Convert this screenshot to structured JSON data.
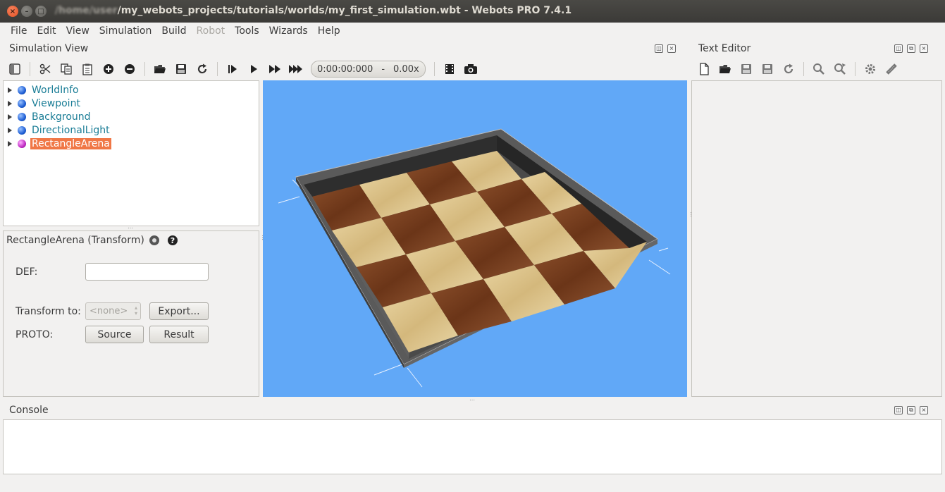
{
  "window": {
    "title_blurred": "/home/user",
    "title": "/my_webots_projects/tutorials/worlds/my_first_simulation.wbt - Webots PRO 7.4.1"
  },
  "menu": [
    {
      "label": "File",
      "enabled": true
    },
    {
      "label": "Edit",
      "enabled": true
    },
    {
      "label": "View",
      "enabled": true
    },
    {
      "label": "Simulation",
      "enabled": true
    },
    {
      "label": "Build",
      "enabled": true
    },
    {
      "label": "Robot",
      "enabled": false
    },
    {
      "label": "Tools",
      "enabled": true
    },
    {
      "label": "Wizards",
      "enabled": true
    },
    {
      "label": "Help",
      "enabled": true
    }
  ],
  "simulation_view": {
    "title": "Simulation View",
    "time": "0:00:00:000",
    "separator": "-",
    "speed": "0.00x"
  },
  "scene_tree": [
    {
      "label": "WorldInfo",
      "color": "blue",
      "selected": false
    },
    {
      "label": "Viewpoint",
      "color": "blue",
      "selected": false
    },
    {
      "label": "Background",
      "color": "blue",
      "selected": false
    },
    {
      "label": "DirectionalLight",
      "color": "blue",
      "selected": false
    },
    {
      "label": "RectangleArena",
      "color": "magenta",
      "selected": true
    }
  ],
  "field_editor": {
    "title": "RectangleArena (Transform)",
    "def_label": "DEF:",
    "def_value": "",
    "transform_label": "Transform to:",
    "transform_value": "<none>",
    "export_label": "Export...",
    "proto_label": "PROTO:",
    "source_label": "Source",
    "result_label": "Result"
  },
  "text_editor": {
    "title": "Text Editor"
  },
  "console": {
    "title": "Console"
  },
  "colors": {
    "sky": "#61a8f7",
    "selection": "#f07746",
    "tree_text": "#1a7d96"
  }
}
